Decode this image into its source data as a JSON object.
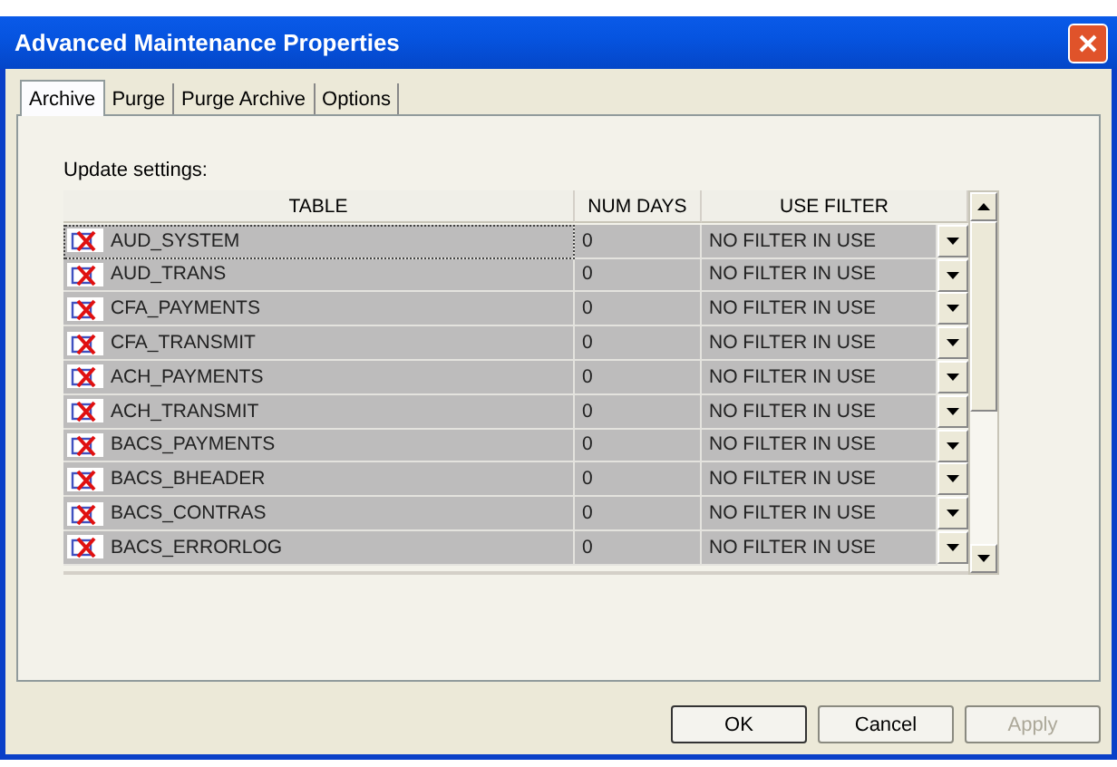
{
  "window": {
    "title": "Advanced Maintenance Properties"
  },
  "tabs": [
    {
      "label": "Archive",
      "selected": true
    },
    {
      "label": "Purge",
      "selected": false
    },
    {
      "label": "Purge Archive",
      "selected": false
    },
    {
      "label": "Options",
      "selected": false
    }
  ],
  "section_label": "Update settings:",
  "table": {
    "columns": [
      "TABLE",
      "NUM DAYS",
      "USE FILTER"
    ],
    "rows": [
      {
        "table": "AUD_SYSTEM",
        "num_days": "0",
        "use_filter": "NO FILTER IN USE",
        "focused": true
      },
      {
        "table": "AUD_TRANS",
        "num_days": "0",
        "use_filter": "NO FILTER IN USE",
        "focused": false
      },
      {
        "table": "CFA_PAYMENTS",
        "num_days": "0",
        "use_filter": "NO FILTER IN USE",
        "focused": false
      },
      {
        "table": "CFA_TRANSMIT",
        "num_days": "0",
        "use_filter": "NO FILTER IN USE",
        "focused": false
      },
      {
        "table": "ACH_PAYMENTS",
        "num_days": "0",
        "use_filter": "NO FILTER IN USE",
        "focused": false
      },
      {
        "table": "ACH_TRANSMIT",
        "num_days": "0",
        "use_filter": "NO FILTER IN USE",
        "focused": false
      },
      {
        "table": "BACS_PAYMENTS",
        "num_days": "0",
        "use_filter": "NO FILTER IN USE",
        "focused": false
      },
      {
        "table": "BACS_BHEADER",
        "num_days": "0",
        "use_filter": "NO FILTER IN USE",
        "focused": false
      },
      {
        "table": "BACS_CONTRAS",
        "num_days": "0",
        "use_filter": "NO FILTER IN USE",
        "focused": false
      },
      {
        "table": "BACS_ERRORLOG",
        "num_days": "0",
        "use_filter": "NO FILTER IN USE",
        "focused": false
      }
    ]
  },
  "buttons": [
    {
      "label": "OK",
      "disabled": false,
      "default": true
    },
    {
      "label": "Cancel",
      "disabled": false,
      "default": false
    },
    {
      "label": "Apply",
      "disabled": true,
      "default": false
    }
  ]
}
